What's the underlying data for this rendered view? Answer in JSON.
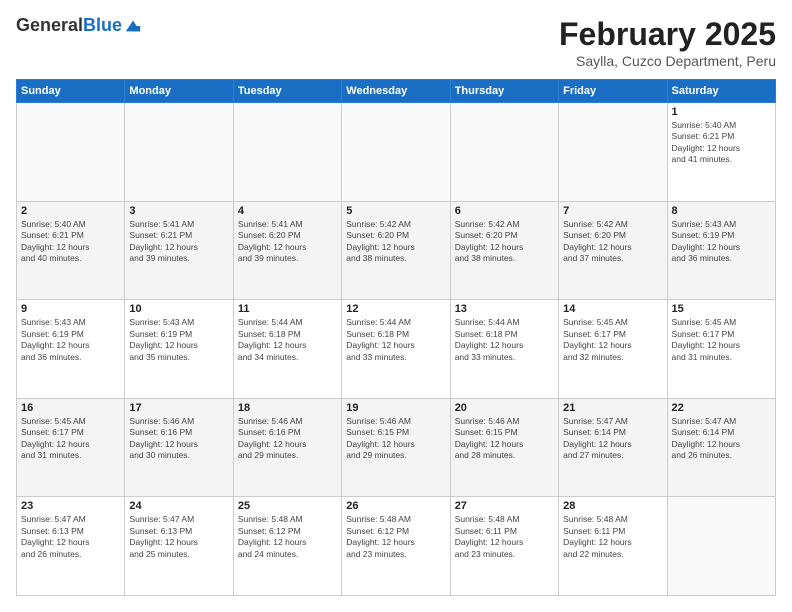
{
  "logo": {
    "general": "General",
    "blue": "Blue"
  },
  "header": {
    "month": "February 2025",
    "location": "Saylla, Cuzco Department, Peru"
  },
  "days_of_week": [
    "Sunday",
    "Monday",
    "Tuesday",
    "Wednesday",
    "Thursday",
    "Friday",
    "Saturday"
  ],
  "weeks": [
    [
      {
        "day": "",
        "info": ""
      },
      {
        "day": "",
        "info": ""
      },
      {
        "day": "",
        "info": ""
      },
      {
        "day": "",
        "info": ""
      },
      {
        "day": "",
        "info": ""
      },
      {
        "day": "",
        "info": ""
      },
      {
        "day": "1",
        "info": "Sunrise: 5:40 AM\nSunset: 6:21 PM\nDaylight: 12 hours\nand 41 minutes."
      }
    ],
    [
      {
        "day": "2",
        "info": "Sunrise: 5:40 AM\nSunset: 6:21 PM\nDaylight: 12 hours\nand 40 minutes."
      },
      {
        "day": "3",
        "info": "Sunrise: 5:41 AM\nSunset: 6:21 PM\nDaylight: 12 hours\nand 39 minutes."
      },
      {
        "day": "4",
        "info": "Sunrise: 5:41 AM\nSunset: 6:20 PM\nDaylight: 12 hours\nand 39 minutes."
      },
      {
        "day": "5",
        "info": "Sunrise: 5:42 AM\nSunset: 6:20 PM\nDaylight: 12 hours\nand 38 minutes."
      },
      {
        "day": "6",
        "info": "Sunrise: 5:42 AM\nSunset: 6:20 PM\nDaylight: 12 hours\nand 38 minutes."
      },
      {
        "day": "7",
        "info": "Sunrise: 5:42 AM\nSunset: 6:20 PM\nDaylight: 12 hours\nand 37 minutes."
      },
      {
        "day": "8",
        "info": "Sunrise: 5:43 AM\nSunset: 6:19 PM\nDaylight: 12 hours\nand 36 minutes."
      }
    ],
    [
      {
        "day": "9",
        "info": "Sunrise: 5:43 AM\nSunset: 6:19 PM\nDaylight: 12 hours\nand 36 minutes."
      },
      {
        "day": "10",
        "info": "Sunrise: 5:43 AM\nSunset: 6:19 PM\nDaylight: 12 hours\nand 35 minutes."
      },
      {
        "day": "11",
        "info": "Sunrise: 5:44 AM\nSunset: 6:18 PM\nDaylight: 12 hours\nand 34 minutes."
      },
      {
        "day": "12",
        "info": "Sunrise: 5:44 AM\nSunset: 6:18 PM\nDaylight: 12 hours\nand 33 minutes."
      },
      {
        "day": "13",
        "info": "Sunrise: 5:44 AM\nSunset: 6:18 PM\nDaylight: 12 hours\nand 33 minutes."
      },
      {
        "day": "14",
        "info": "Sunrise: 5:45 AM\nSunset: 6:17 PM\nDaylight: 12 hours\nand 32 minutes."
      },
      {
        "day": "15",
        "info": "Sunrise: 5:45 AM\nSunset: 6:17 PM\nDaylight: 12 hours\nand 31 minutes."
      }
    ],
    [
      {
        "day": "16",
        "info": "Sunrise: 5:45 AM\nSunset: 6:17 PM\nDaylight: 12 hours\nand 31 minutes."
      },
      {
        "day": "17",
        "info": "Sunrise: 5:46 AM\nSunset: 6:16 PM\nDaylight: 12 hours\nand 30 minutes."
      },
      {
        "day": "18",
        "info": "Sunrise: 5:46 AM\nSunset: 6:16 PM\nDaylight: 12 hours\nand 29 minutes."
      },
      {
        "day": "19",
        "info": "Sunrise: 5:46 AM\nSunset: 6:15 PM\nDaylight: 12 hours\nand 29 minutes."
      },
      {
        "day": "20",
        "info": "Sunrise: 5:46 AM\nSunset: 6:15 PM\nDaylight: 12 hours\nand 28 minutes."
      },
      {
        "day": "21",
        "info": "Sunrise: 5:47 AM\nSunset: 6:14 PM\nDaylight: 12 hours\nand 27 minutes."
      },
      {
        "day": "22",
        "info": "Sunrise: 5:47 AM\nSunset: 6:14 PM\nDaylight: 12 hours\nand 26 minutes."
      }
    ],
    [
      {
        "day": "23",
        "info": "Sunrise: 5:47 AM\nSunset: 6:13 PM\nDaylight: 12 hours\nand 26 minutes."
      },
      {
        "day": "24",
        "info": "Sunrise: 5:47 AM\nSunset: 6:13 PM\nDaylight: 12 hours\nand 25 minutes."
      },
      {
        "day": "25",
        "info": "Sunrise: 5:48 AM\nSunset: 6:12 PM\nDaylight: 12 hours\nand 24 minutes."
      },
      {
        "day": "26",
        "info": "Sunrise: 5:48 AM\nSunset: 6:12 PM\nDaylight: 12 hours\nand 23 minutes."
      },
      {
        "day": "27",
        "info": "Sunrise: 5:48 AM\nSunset: 6:11 PM\nDaylight: 12 hours\nand 23 minutes."
      },
      {
        "day": "28",
        "info": "Sunrise: 5:48 AM\nSunset: 6:11 PM\nDaylight: 12 hours\nand 22 minutes."
      },
      {
        "day": "",
        "info": ""
      }
    ]
  ]
}
